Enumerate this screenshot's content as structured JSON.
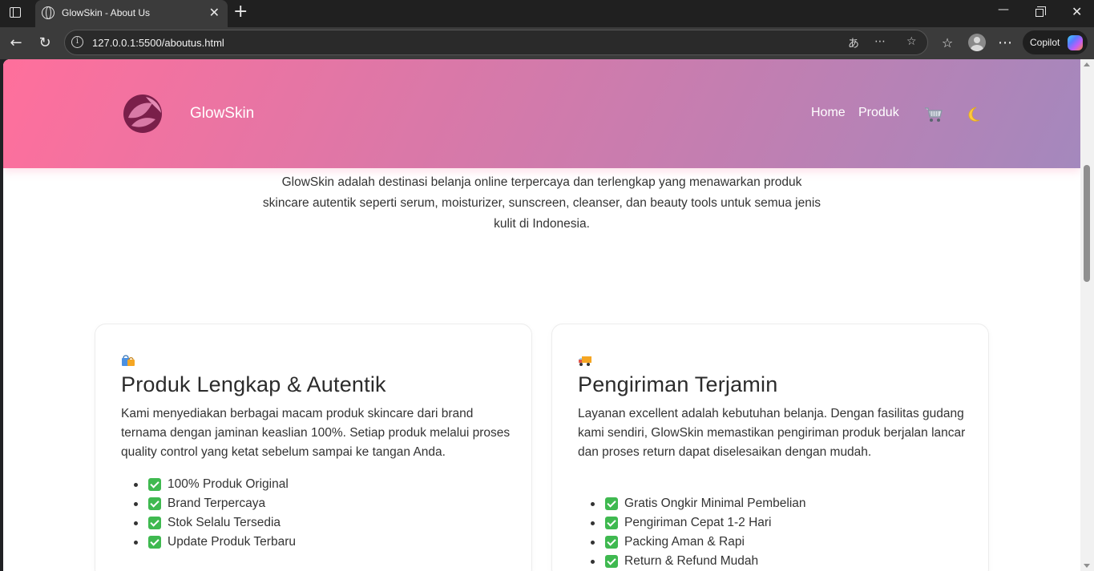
{
  "browser": {
    "tab_title": "GlowSkin - About Us",
    "url": "127.0.0.1:5500/aboutus.html",
    "copilot_label": "Copilot"
  },
  "site": {
    "brand": "GlowSkin",
    "nav": [
      {
        "label": "Home"
      },
      {
        "label": "Produk"
      }
    ],
    "icons": [
      "cart-icon",
      "moon-icon"
    ],
    "header_gradient": [
      "#ff6f9c",
      "#a488bd"
    ]
  },
  "intro": {
    "text": "GlowSkin adalah destinasi belanja online terpercaya dan terlengkap yang menawarkan produk skincare autentik seperti serum, moisturizer, sunscreen, cleanser, dan beauty tools untuk semua jenis kulit di Indonesia."
  },
  "cards": [
    {
      "icon": "shopping-bags-icon",
      "title": "Produk Lengkap & Autentik",
      "text": "Kami menyediakan berbagai macam produk skincare dari brand ternama dengan jaminan keaslian 100%. Setiap produk melalui proses quality control yang ketat sebelum sampai ke tangan Anda.",
      "items": [
        "100% Produk Original",
        "Brand Terpercaya",
        "Stok Selalu Tersedia",
        "Update Produk Terbaru"
      ]
    },
    {
      "icon": "delivery-truck-icon",
      "title": "Pengiriman Terjamin",
      "text": "Layanan excellent adalah kebutuhan belanja. Dengan fasilitas gudang kami sendiri, GlowSkin memastikan pengiriman produk berjalan lancar dan proses return dapat diselesaikan dengan mudah.",
      "items": [
        "Gratis Ongkir Minimal Pembelian",
        "Pengiriman Cepat 1-2 Hari",
        "Packing Aman & Rapi",
        "Return & Refund Mudah"
      ]
    }
  ]
}
